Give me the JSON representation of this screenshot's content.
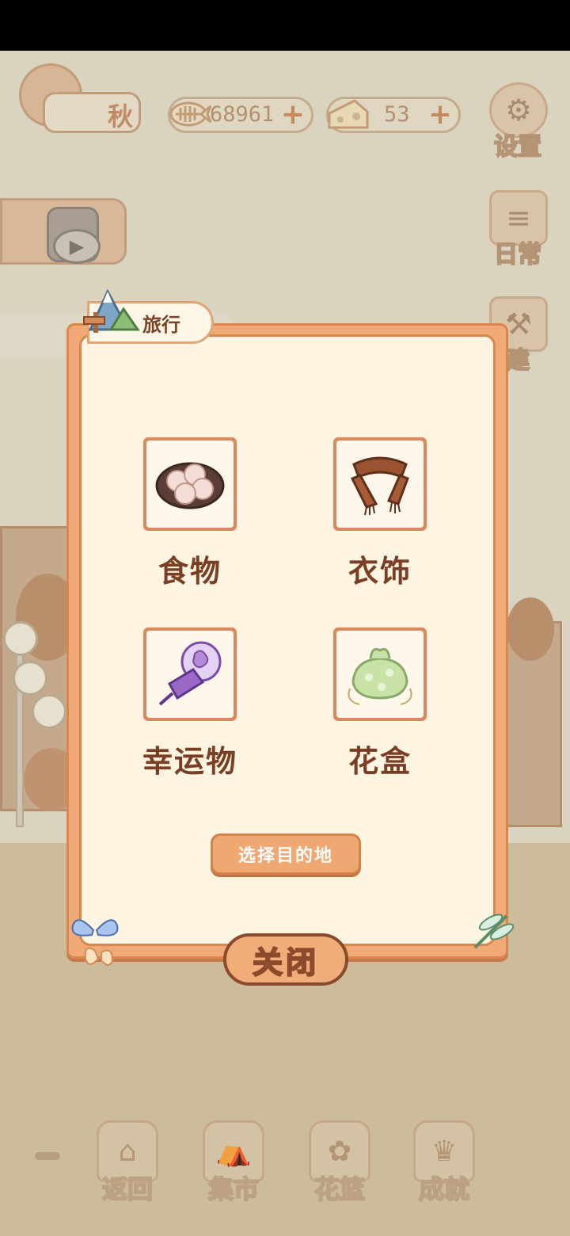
{
  "hud": {
    "season_label": "秋",
    "fish_count": "68961",
    "cheese_count": "53",
    "plus": "+"
  },
  "side_buttons": {
    "settings": "设置",
    "daily": "日常",
    "build": "建"
  },
  "modal": {
    "title": "旅行",
    "items": [
      {
        "label": "食物",
        "icon": "food-plate-icon"
      },
      {
        "label": "衣饰",
        "icon": "scarf-icon"
      },
      {
        "label": "幸运物",
        "icon": "fan-charm-icon"
      },
      {
        "label": "花盒",
        "icon": "flower-bundle-icon"
      }
    ],
    "choose_button": "选择目的地",
    "close_button": "关闭"
  },
  "bottom_nav": {
    "back": "返回",
    "market": "集市",
    "basket": "花篮",
    "achievements": "成就"
  },
  "colors": {
    "modal_border": "#f0a977",
    "modal_bg": "#fdf5e1",
    "text_brown": "#7a3e25",
    "button_orange": "#f0a873"
  }
}
